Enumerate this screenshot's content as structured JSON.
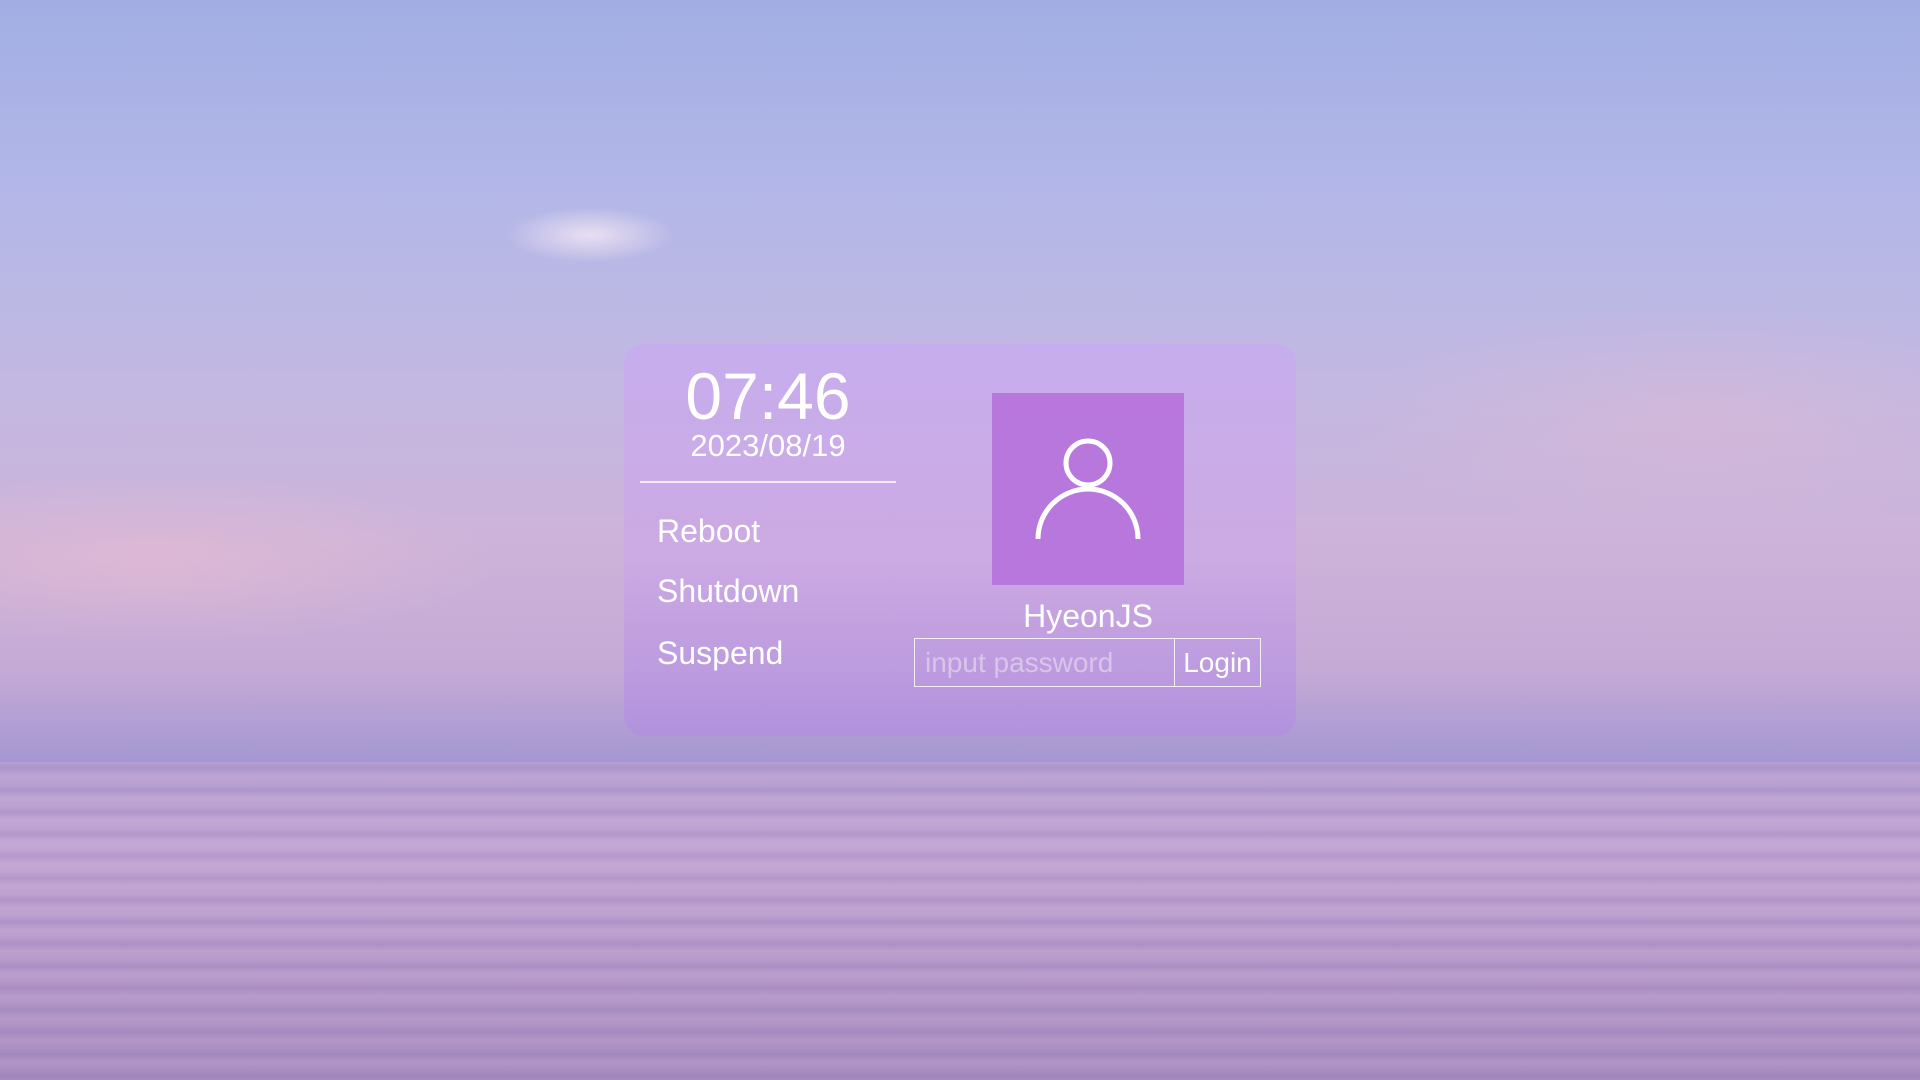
{
  "clock": {
    "time": "07:46",
    "date": "2023/08/19"
  },
  "power_menu": [
    {
      "label": "Reboot"
    },
    {
      "label": "Shutdown"
    },
    {
      "label": "Suspend"
    }
  ],
  "user": {
    "name": "HyeonJS",
    "avatar_icon": "user-icon",
    "avatar_color": "#b877dd"
  },
  "login": {
    "password_value": "",
    "password_placeholder": "input password",
    "button_label": "Login"
  }
}
